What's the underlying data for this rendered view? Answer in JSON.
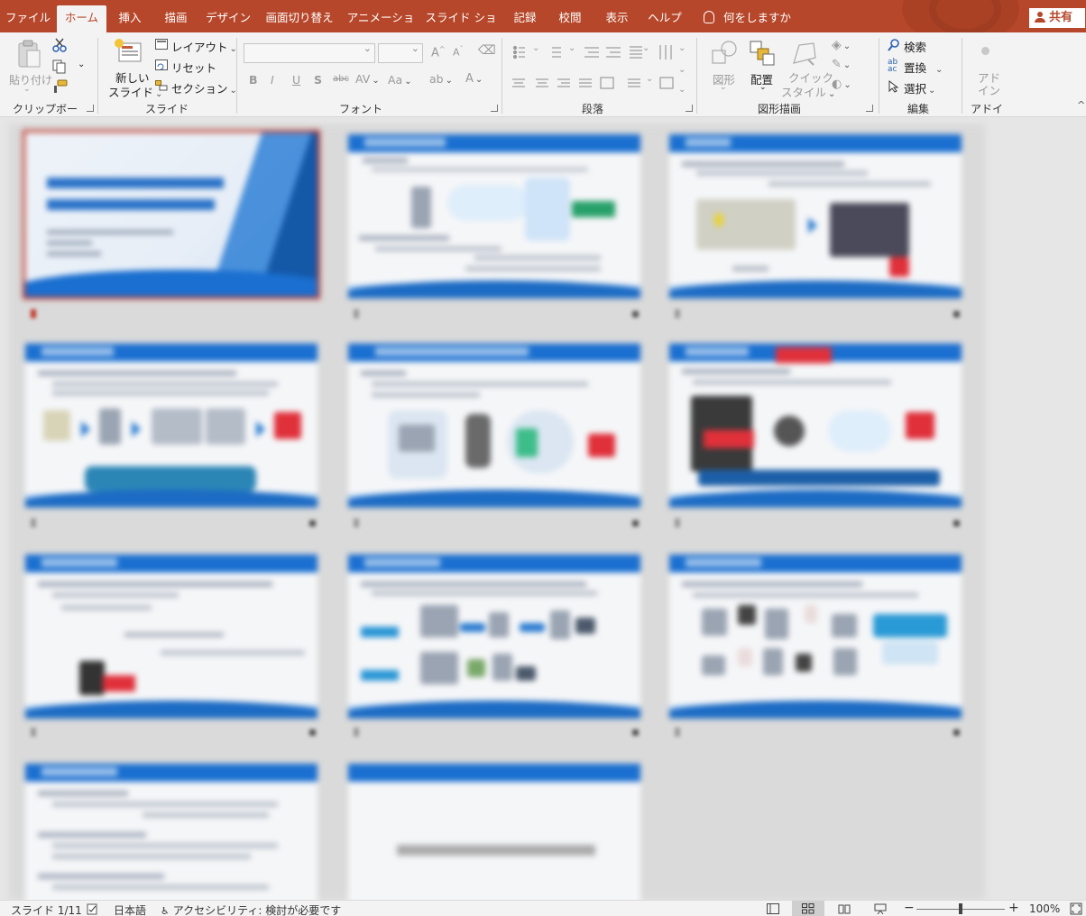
{
  "tabs": [
    "ファイル",
    "ホーム",
    "挿入",
    "描画",
    "デザイン",
    "画面切り替え",
    "アニメーション",
    "スライド ショー",
    "記録",
    "校閲",
    "表示",
    "ヘルプ"
  ],
  "active_tab": "ホーム",
  "tell_me": "何をしますか",
  "share": "共有",
  "ribbon": {
    "clipboard": {
      "paste": "貼り付け",
      "label": "クリップボード"
    },
    "slides": {
      "new_slide_1": "新しい",
      "new_slide_2": "スライド",
      "layout": "レイアウト",
      "reset": "リセット",
      "section": "セクション",
      "label": "スライド"
    },
    "font": {
      "label": "フォント",
      "bold": "B",
      "italic": "I",
      "underline": "U",
      "shadow": "S",
      "strike": "abc",
      "case": "Aa"
    },
    "paragraph": {
      "label": "段落"
    },
    "drawing": {
      "shapes": "図形",
      "arrange": "配置",
      "quick_style_1": "クイック",
      "quick_style_2": "スタイル",
      "label": "図形描画"
    },
    "editing": {
      "find": "検索",
      "replace": "置換",
      "select": "選択",
      "label": "編集"
    },
    "addins": {
      "addin_1": "アド",
      "addin_2": "イン",
      "label": "アドイン"
    }
  },
  "status": {
    "slide_info": "スライド 1/11",
    "language": "日本語",
    "accessibility": "アクセシビリティ: 検討が必要です",
    "zoom": "100%",
    "zoom_minus": "−",
    "zoom_plus": "+"
  },
  "colors": {
    "accent": "#b7472a",
    "slide_blue": "#1a6fd0",
    "selected_border": "#c0392b"
  }
}
